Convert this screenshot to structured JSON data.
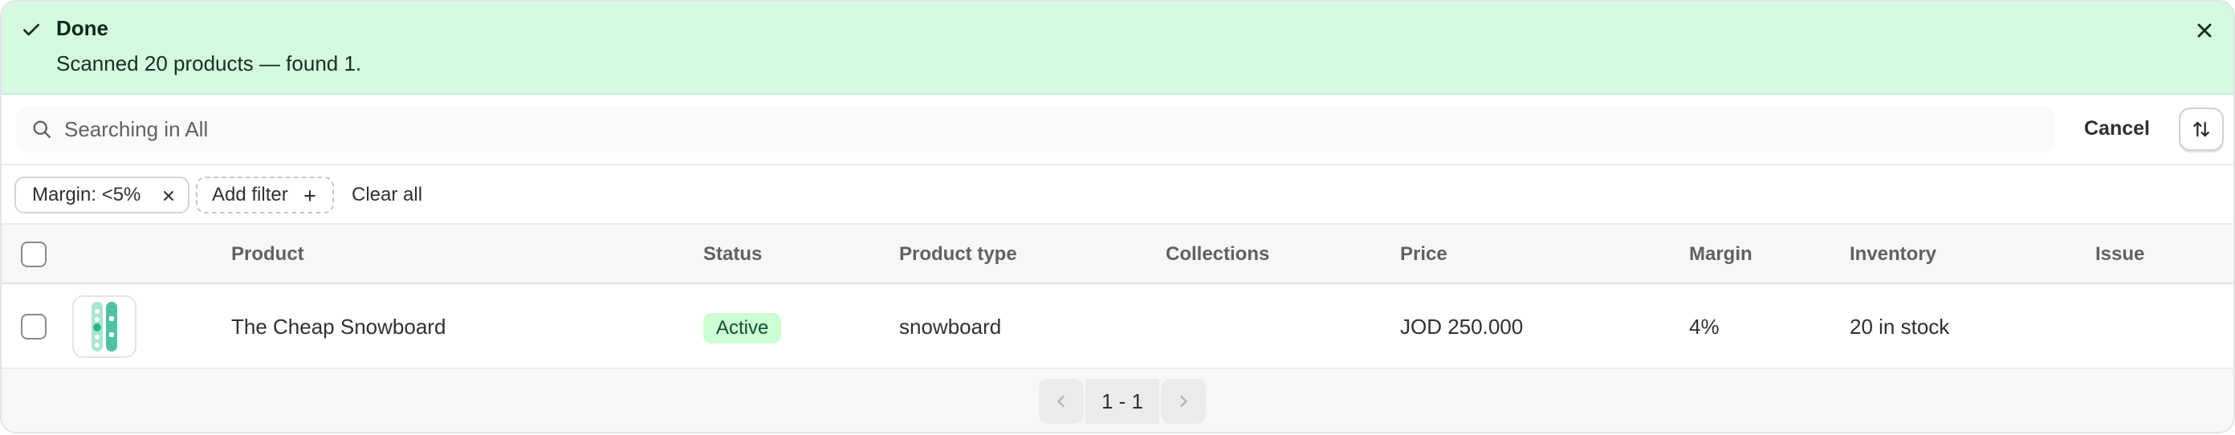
{
  "banner": {
    "title": "Done",
    "message": "Scanned 20 products — found 1.",
    "color": "#d5f8e1"
  },
  "search": {
    "placeholder": "Searching in All",
    "value": "",
    "cancel_label": "Cancel",
    "sort_icon": "sort-icon"
  },
  "filters": {
    "chips": [
      {
        "label": "Margin: <5%"
      },
      {
        "label": "Add filter"
      }
    ],
    "clear_all_label": "Clear all"
  },
  "table": {
    "columns": [
      "Product",
      "Status",
      "Product type",
      "Collections",
      "Price",
      "Margin",
      "Inventory",
      "Issue"
    ],
    "rows": [
      {
        "product": "The Cheap Snowboard",
        "status": "Active",
        "product_type": "snowboard",
        "collections": "",
        "price": "JOD 250.000",
        "margin": "4%",
        "inventory": "20 in stock",
        "issue": ""
      }
    ]
  },
  "pagination": {
    "label": "1 - 1"
  },
  "colors": {
    "status_active_bg": "#cdfed4",
    "status_active_text": "#0c5132"
  }
}
